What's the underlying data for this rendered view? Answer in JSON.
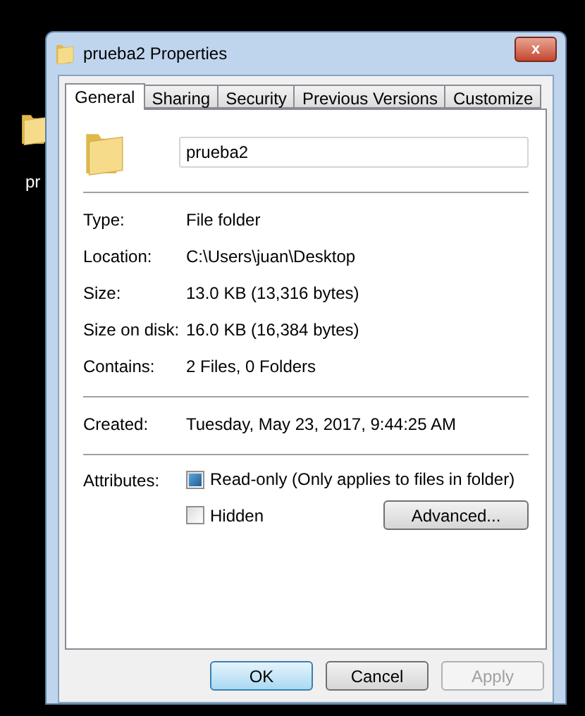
{
  "desktop": {
    "icon_label": "pr"
  },
  "window": {
    "title": "prueba2 Properties",
    "close": "x"
  },
  "tabs": [
    {
      "label": "General",
      "selected": true
    },
    {
      "label": "Sharing",
      "selected": false
    },
    {
      "label": "Security",
      "selected": false
    },
    {
      "label": "Previous Versions",
      "selected": false
    },
    {
      "label": "Customize",
      "selected": false
    }
  ],
  "name_field": {
    "value": "prueba2"
  },
  "groups": [
    [
      {
        "label": "Type:",
        "value": "File folder"
      },
      {
        "label": "Location:",
        "value": "C:\\Users\\juan\\Desktop"
      },
      {
        "label": "Size:",
        "value": "13.0 KB (13,316 bytes)"
      },
      {
        "label": "Size on disk:",
        "value": "16.0 KB (16,384 bytes)"
      },
      {
        "label": "Contains:",
        "value": "2 Files, 0 Folders"
      }
    ],
    [
      {
        "label": "Created:",
        "value": "Tuesday, May 23, 2017, 9:44:25 AM"
      }
    ]
  ],
  "attributes": {
    "label": "Attributes:",
    "options": [
      {
        "label": "Read-only (Only applies to files in folder)",
        "checked": true
      },
      {
        "label": "Hidden",
        "checked": false
      }
    ],
    "advanced": "Advanced..."
  },
  "buttons": [
    {
      "label": "OK",
      "default": true,
      "disabled": false
    },
    {
      "label": "Cancel",
      "default": false,
      "disabled": false
    },
    {
      "label": "Apply",
      "default": false,
      "disabled": true
    }
  ]
}
